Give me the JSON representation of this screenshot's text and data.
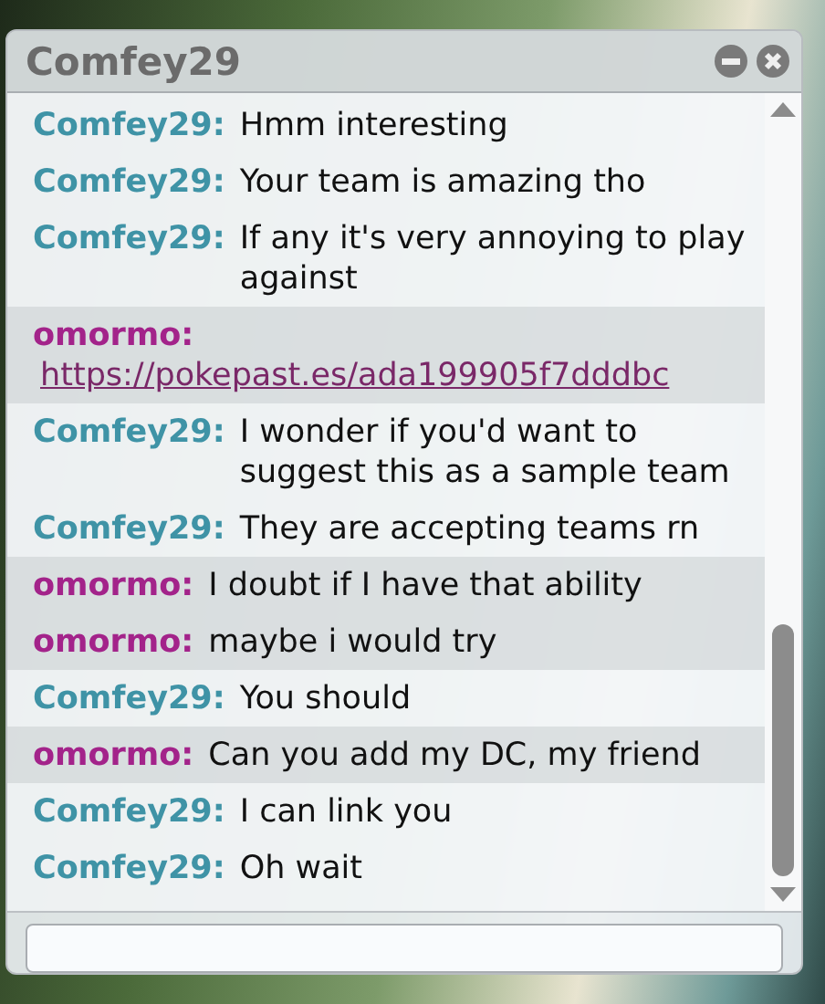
{
  "window": {
    "title": "Comfey29"
  },
  "messages": [
    {
      "sender": "Comfey29:",
      "color": "#3f93a6",
      "shaded": false,
      "kind": "text",
      "text": "Hmm interesting"
    },
    {
      "sender": "Comfey29:",
      "color": "#3f93a6",
      "shaded": false,
      "kind": "text",
      "text": "Your team is amazing tho"
    },
    {
      "sender": "Comfey29:",
      "color": "#3f93a6",
      "shaded": false,
      "kind": "text",
      "text": "If any it's very annoying to play against"
    },
    {
      "sender": "omormo:",
      "color": "#a3238a",
      "shaded": true,
      "kind": "link",
      "text": "https://pokepast.es/ada199905f7dddbc"
    },
    {
      "sender": "Comfey29:",
      "color": "#3f93a6",
      "shaded": false,
      "kind": "text",
      "text": "I wonder if you'd want to suggest this as a sample team"
    },
    {
      "sender": "Comfey29:",
      "color": "#3f93a6",
      "shaded": false,
      "kind": "text",
      "text": "They are accepting teams rn"
    },
    {
      "sender": "omormo:",
      "color": "#a3238a",
      "shaded": true,
      "kind": "text",
      "text": "I doubt if I have that ability"
    },
    {
      "sender": "omormo:",
      "color": "#a3238a",
      "shaded": true,
      "kind": "text",
      "text": "maybe i would try"
    },
    {
      "sender": "Comfey29:",
      "color": "#3f93a6",
      "shaded": false,
      "kind": "text",
      "text": "You should"
    },
    {
      "sender": "omormo:",
      "color": "#a3238a",
      "shaded": true,
      "kind": "text",
      "text": "Can you add my DC, my friend"
    },
    {
      "sender": "Comfey29:",
      "color": "#3f93a6",
      "shaded": false,
      "kind": "text",
      "text": "I can link you"
    },
    {
      "sender": "Comfey29:",
      "color": "#3f93a6",
      "shaded": false,
      "kind": "text",
      "text": "Oh wait"
    }
  ]
}
